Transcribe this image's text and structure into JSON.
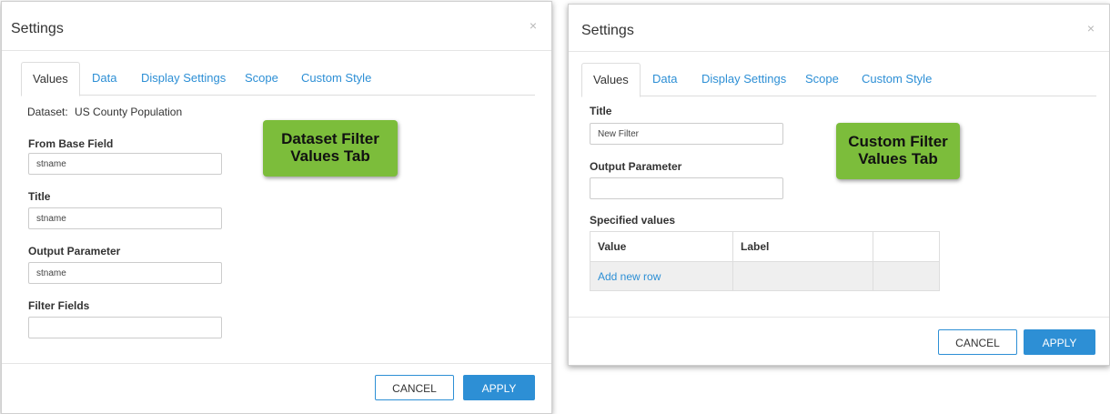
{
  "left_dialog": {
    "title": "Settings",
    "close_symbol": "×",
    "tabs": [
      "Values",
      "Data",
      "Display Settings",
      "Scope",
      "Custom Style"
    ],
    "active_tab": "Values",
    "dataset_label": "Dataset:",
    "dataset_value": "US County Population",
    "fields": [
      {
        "label": "From Base Field",
        "value": "stname"
      },
      {
        "label": "Title",
        "value": "stname"
      },
      {
        "label": "Output Parameter",
        "value": "stname"
      },
      {
        "label": "Filter Fields",
        "value": ""
      }
    ],
    "callout": {
      "line1": "Dataset Filter",
      "line2": "Values Tab"
    },
    "cancel_label": "CANCEL",
    "apply_label": "APPLY"
  },
  "right_dialog": {
    "title": "Settings",
    "close_symbol": "×",
    "tabs": [
      "Values",
      "Data",
      "Display Settings",
      "Scope",
      "Custom Style"
    ],
    "active_tab": "Values",
    "fields": [
      {
        "label": "Title",
        "value": "New Filter"
      },
      {
        "label": "Output Parameter",
        "value": ""
      }
    ],
    "specified_values_label": "Specified values",
    "table": {
      "headers": [
        "Value",
        "Label",
        ""
      ],
      "add_row_label": "Add new row"
    },
    "callout": {
      "line1": "Custom Filter",
      "line2": "Values Tab"
    },
    "cancel_label": "CANCEL",
    "apply_label": "APPLY"
  },
  "colors": {
    "accent": "#2d8fd5",
    "callout_green": "#7cbd3b",
    "table_row_bg": "#efefef"
  }
}
